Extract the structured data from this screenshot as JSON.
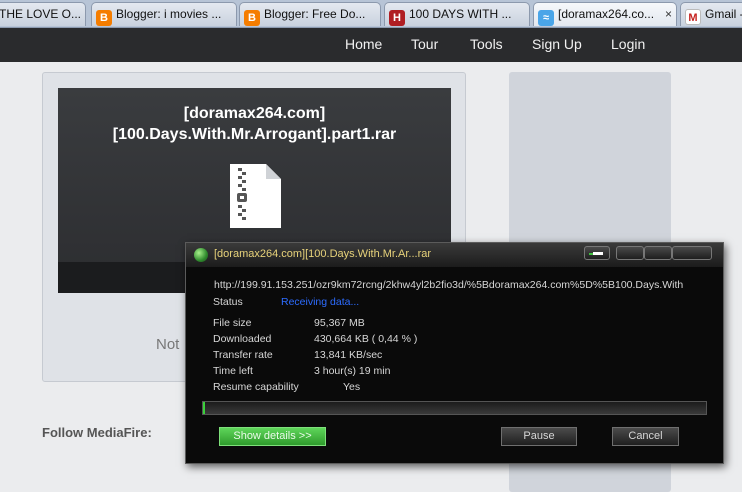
{
  "browser": {
    "tabs": [
      {
        "label": "THE LOVE O...",
        "favicon": "none",
        "active": false
      },
      {
        "label": "Blogger: i movies ...",
        "favicon": "blogger-icon",
        "active": false
      },
      {
        "label": "Blogger: Free Do...",
        "favicon": "blogger-icon",
        "active": false
      },
      {
        "label": "100 DAYS WITH ...",
        "favicon": "site-icon",
        "active": false
      },
      {
        "label": "[doramax264.co...",
        "favicon": "mediafire-icon",
        "active": true
      },
      {
        "label": "Gmail -",
        "favicon": "gmail-icon",
        "active": false
      }
    ],
    "close_glyph": "×"
  },
  "nav": {
    "links": [
      "Home",
      "Tour",
      "Tools",
      "Sign Up",
      "Login"
    ]
  },
  "file": {
    "name_line1": "[doramax264.com]",
    "name_line2": "[100.Days.With.Mr.Arrogant].part1.rar",
    "icon": "zip-file-icon"
  },
  "page": {
    "not_text": "Not",
    "follow_label": "Follow MediaFire:"
  },
  "download": {
    "title": "[doramax264.com][100.Days.With.Mr.Ar...rar",
    "url": "http://199.91.153.251/ozr9km72rcng/2khw4yl2b2fio3d/%5Bdoramax264.com%5D%5B100.Days.With",
    "status_label": "Status",
    "status_value": "Receiving data...",
    "fields": [
      {
        "label": "File size",
        "value": "95,367  MB"
      },
      {
        "label": "Downloaded",
        "value": "430,664  KB  ( 0,44 % )"
      },
      {
        "label": "Transfer rate",
        "value": "13,841  KB/sec"
      },
      {
        "label": "Time left",
        "value": "3 hour(s) 19 min"
      }
    ],
    "resume_label": "Resume capability",
    "resume_value": "Yes",
    "progress_fraction": 0.0044,
    "buttons": {
      "details": "Show details >>",
      "pause": "Pause",
      "cancel": "Cancel"
    }
  },
  "colors": {
    "nav_bg": "#2a2b2d",
    "dialog_bg": "#0a0a0a",
    "progress_green": "#3ad13a",
    "status_blue": "#2d6cff",
    "title_yellow": "#e7d27a"
  }
}
